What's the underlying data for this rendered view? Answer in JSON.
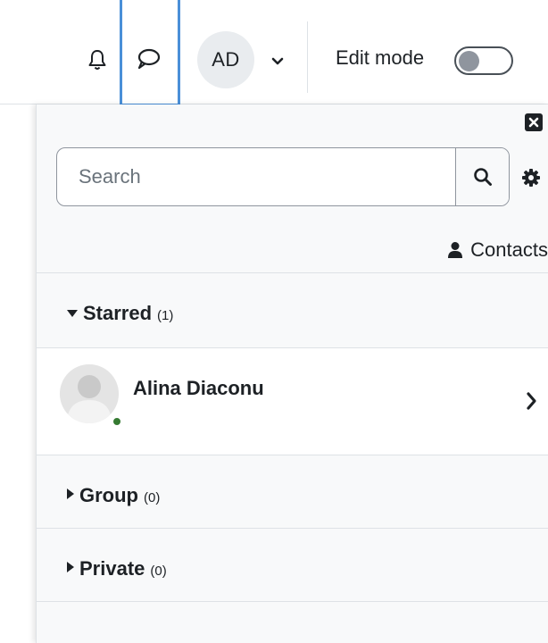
{
  "navbar": {
    "notifications_icon": "bell-icon",
    "messages_icon": "speech-bubble-icon",
    "user_initials": "AD",
    "user_menu_icon": "chevron-down-icon",
    "edit_mode_label": "Edit mode",
    "edit_mode_on": false
  },
  "drawer": {
    "close_icon": "close-icon",
    "search": {
      "placeholder": "Search",
      "value": "",
      "icon": "search-icon"
    },
    "settings_icon": "gear-icon",
    "contacts": {
      "label": "Contacts",
      "icon": "user-icon"
    },
    "sections": {
      "starred": {
        "title": "Starred",
        "count": "(1)",
        "expanded": true
      },
      "group": {
        "title": "Group",
        "count": "(0)",
        "expanded": false
      },
      "private": {
        "title": "Private",
        "count": "(0)",
        "expanded": false
      }
    },
    "starred_contacts": [
      {
        "name": "Alina Diaconu",
        "status": "online"
      }
    ]
  },
  "colors": {
    "highlight_border": "#4a8fd8",
    "online": "#357a32",
    "drawer_bg": "#f8f9fa",
    "text": "#1d2125"
  }
}
